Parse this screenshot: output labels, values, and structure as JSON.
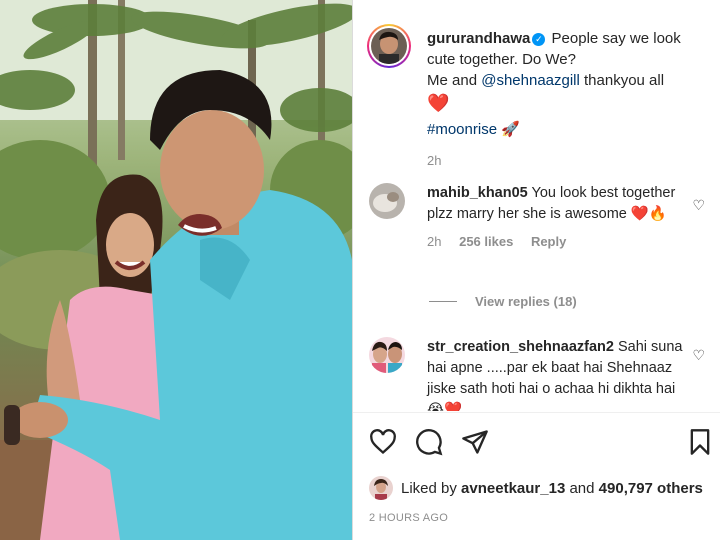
{
  "post": {
    "author": "gururandhawa",
    "caption_line1": "People say we look cute together. Do We?",
    "caption_line2_prefix": "Me and",
    "caption_mention": "@shehnaazgill",
    "caption_line2_suffix": "thankyou all",
    "caption_heart": "❤️",
    "hashtag": "#moonrise",
    "hashtag_emoji": "🚀",
    "age": "2h"
  },
  "comments": [
    {
      "user": "mahib_khan05",
      "text": "You look best together plzz marry her she is awesome",
      "emoji": "❤️🔥",
      "age": "2h",
      "likes": "256 likes",
      "reply_label": "Reply",
      "view_replies": "View replies (18)"
    },
    {
      "user": "str_creation_shehnaazfan2",
      "text": "Sahi suna hai apne .....par ek baat hai Shehnaaz jiske sath hoti hai o achaa hi dikhta hai",
      "emoji": "😭❤️"
    }
  ],
  "footer": {
    "liked_by_prefix": "Liked by",
    "liked_by_user": "avneetkaur_13",
    "liked_by_and": "and",
    "liked_by_count": "490,797 others",
    "timestamp": "2 HOURS AGO"
  },
  "icons": {
    "like": "heart-outline-icon",
    "comment": "comment-bubble-icon",
    "share": "paper-plane-icon",
    "save": "bookmark-icon"
  },
  "colors": {
    "accent_link": "#00376b",
    "verified": "#0095f6",
    "heart": "#ed1c24",
    "muted": "#8e8e8e"
  }
}
